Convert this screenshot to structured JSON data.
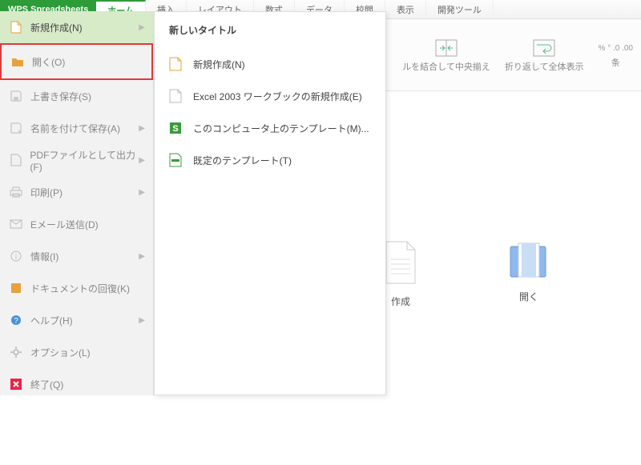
{
  "app": {
    "title": "WPS Spreadsheets"
  },
  "tabs": {
    "home": "ホーム",
    "insert": "挿入",
    "layout": "レイアウト",
    "formula": "数式",
    "data": "データ",
    "review": "校閲",
    "view": "表示",
    "dev": "開発ツール"
  },
  "ribbon": {
    "merge": "ルを結合して中央揃え",
    "wrap": "折り返して全体表示",
    "rightcut": "条"
  },
  "sidebar": {
    "new": "新規作成(N)",
    "open": "開く(O)",
    "save": "上書き保存(S)",
    "saveas": "名前を付けて保存(A)",
    "pdf": "PDFファイルとして出力(F)",
    "print": "印刷(P)",
    "email": "Eメール送信(D)",
    "info": "情報(I)",
    "recover": "ドキュメントの回復(K)",
    "help": "ヘルプ(H)",
    "options": "オプション(L)",
    "exit": "終了(Q)"
  },
  "submenu": {
    "title": "新しいタイトル",
    "new": "新規作成(N)",
    "excel": "Excel 2003 ワークブックの新規作成(E)",
    "template": "このコンピュータ上のテンプレート(M)...",
    "default": "既定のテンプレート(T)"
  },
  "mainIcons": {
    "new": "作成",
    "open": "開く"
  }
}
